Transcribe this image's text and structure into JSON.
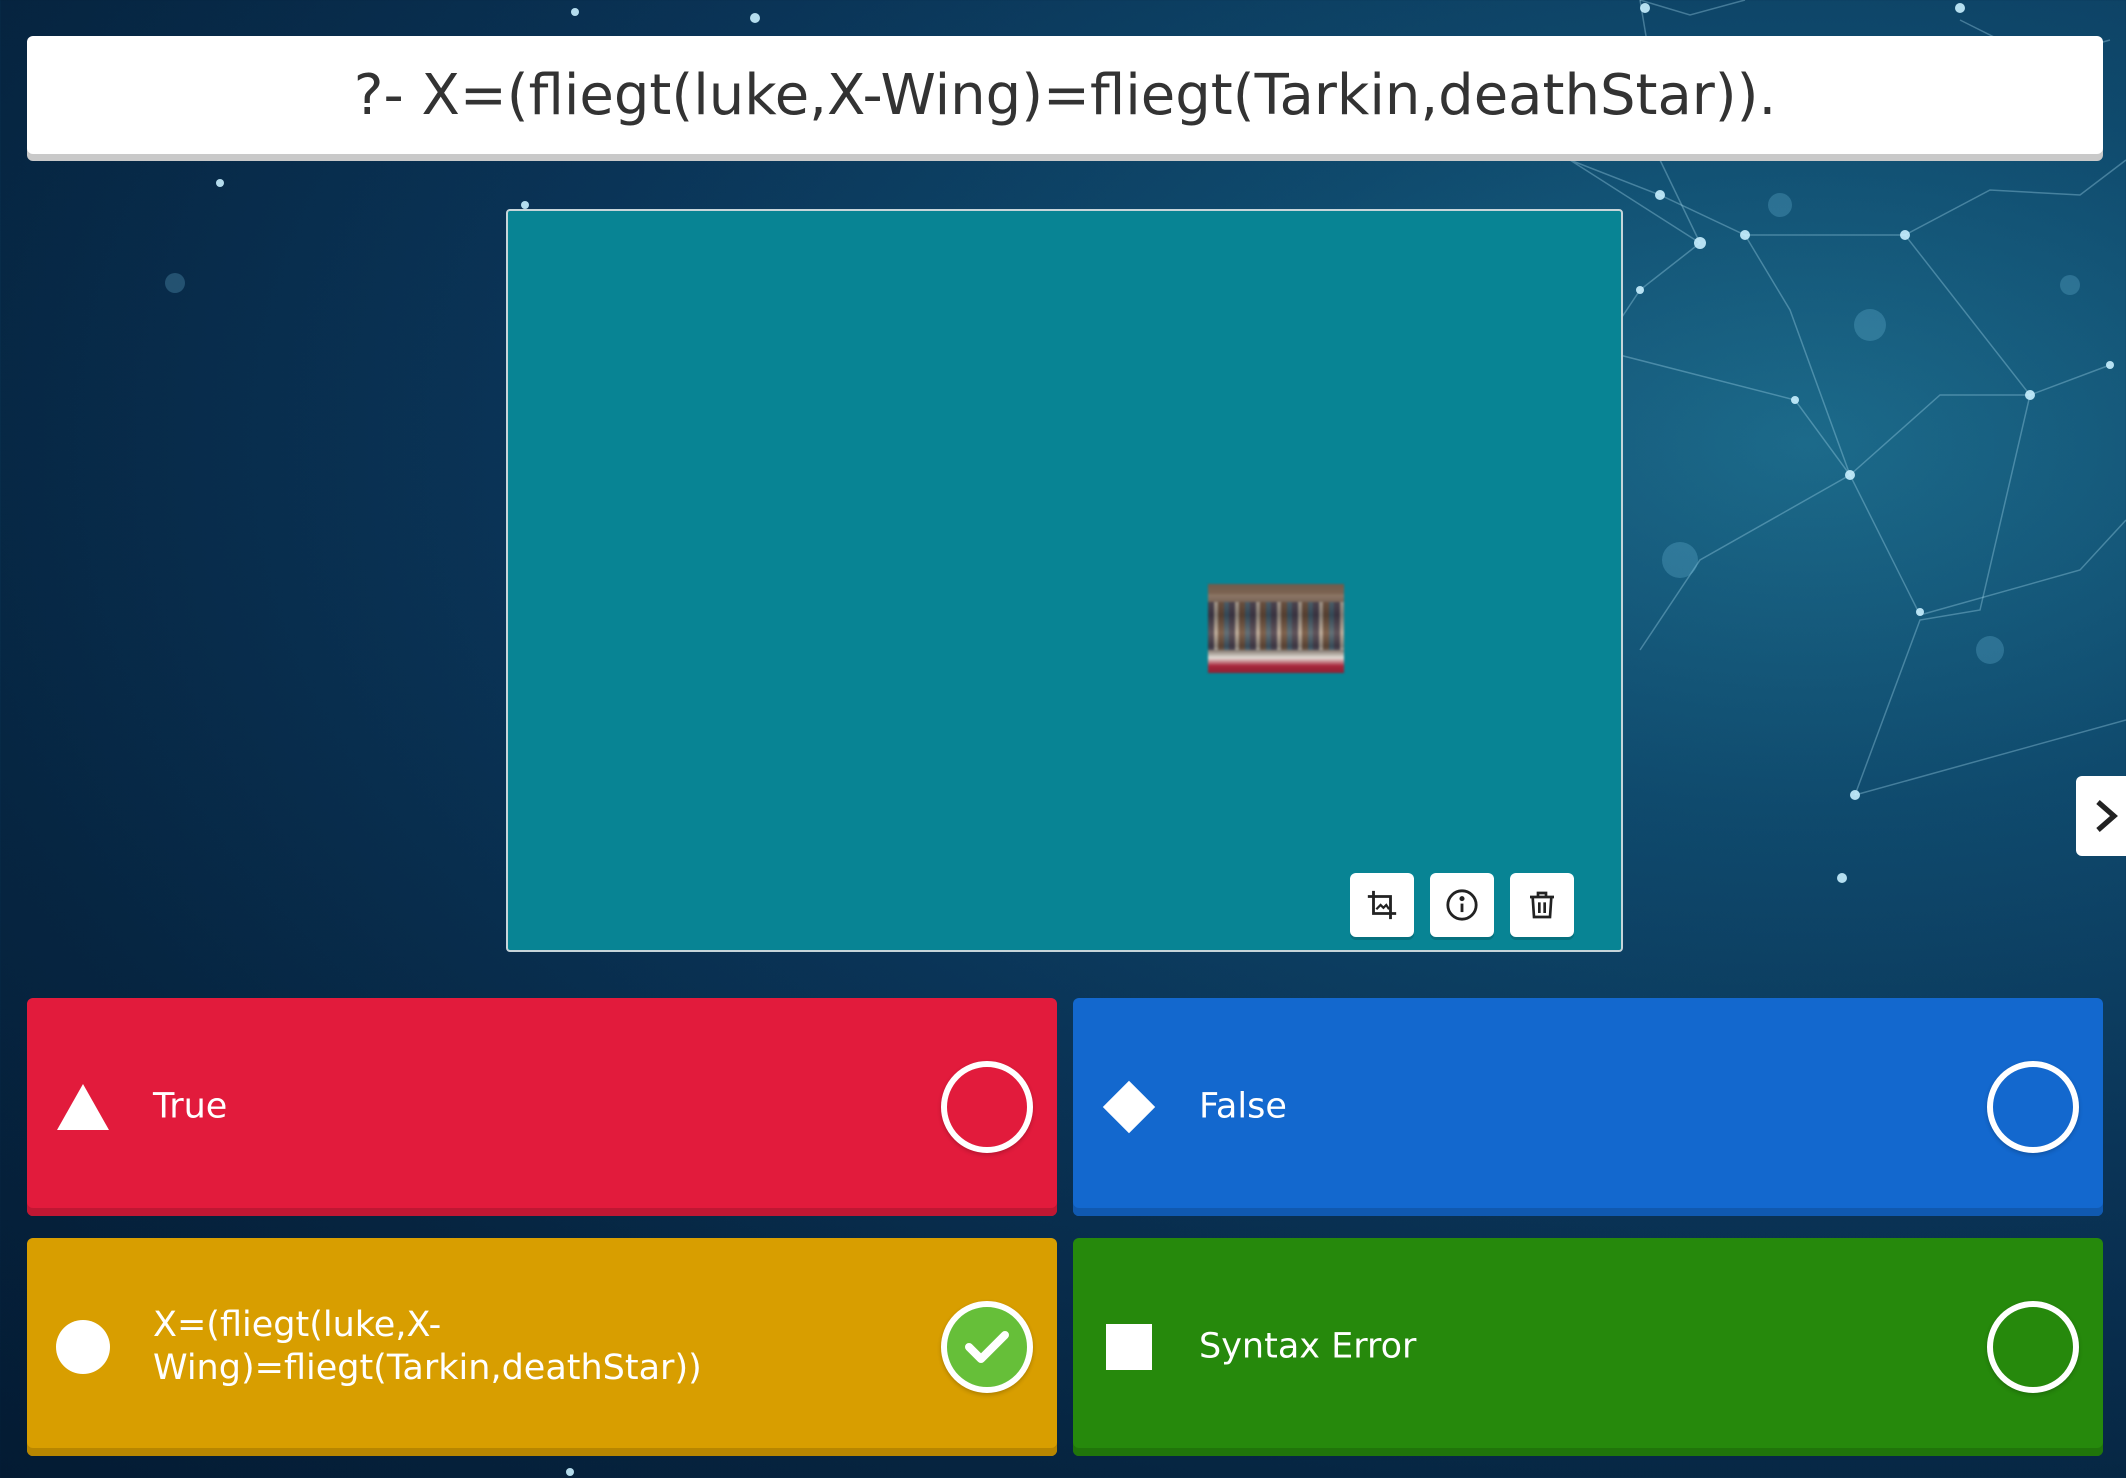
{
  "question": {
    "text": "?- X=(fliegt(luke,X-Wing)=fliegt(Tarkin,deathStar))."
  },
  "media": {
    "background_color": "#088494",
    "image_icon": "bookshelf-thumbnail",
    "tools": [
      {
        "name": "crop-image-icon"
      },
      {
        "name": "info-icon"
      },
      {
        "name": "trash-icon"
      }
    ]
  },
  "navigation": {
    "next_icon": "chevron-right-icon"
  },
  "answers": [
    {
      "label": "True",
      "shape": "triangle",
      "color": "#e21b3c",
      "correct": false
    },
    {
      "label": "False",
      "shape": "diamond",
      "color": "#1368ce",
      "correct": false
    },
    {
      "label": "X=(fliegt(luke,X-Wing)=fliegt(Tarkin,deathStar))",
      "shape": "circle",
      "color": "#d89e00",
      "correct": true
    },
    {
      "label": "Syntax Error",
      "shape": "square",
      "color": "#26890c",
      "correct": false
    }
  ],
  "colors": {
    "correct_check": "#66bf39",
    "background_dark": "#041b33",
    "background_accent": "#1c6a8a"
  }
}
